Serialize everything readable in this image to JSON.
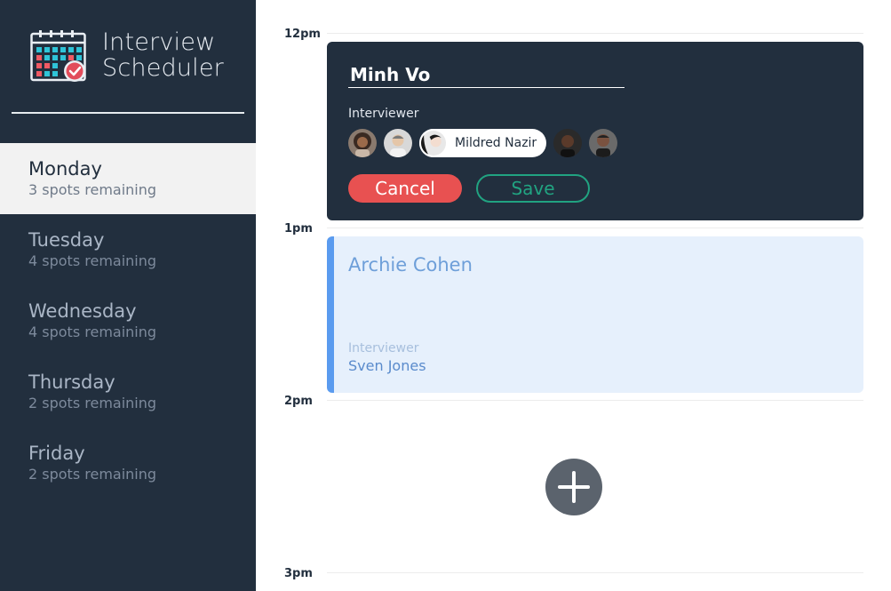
{
  "app": {
    "title_line1": "Interview",
    "title_line2": "Scheduler"
  },
  "sidebar": {
    "days": [
      {
        "name": "Monday",
        "spots": "3 spots remaining",
        "selected": true
      },
      {
        "name": "Tuesday",
        "spots": "4 spots remaining",
        "selected": false
      },
      {
        "name": "Wednesday",
        "spots": "4 spots remaining",
        "selected": false
      },
      {
        "name": "Thursday",
        "spots": "2 spots remaining",
        "selected": false
      },
      {
        "name": "Friday",
        "spots": "2 spots remaining",
        "selected": false
      }
    ]
  },
  "schedule": {
    "times": [
      "12pm",
      "1pm",
      "2pm",
      "3pm"
    ],
    "form": {
      "student_name": "Minh Vo",
      "interviewer_label": "Interviewer",
      "selected_interviewer": "Mildred Nazir",
      "cancel_label": "Cancel",
      "save_label": "Save"
    },
    "appointment": {
      "student": "Archie Cohen",
      "interviewer_label": "Interviewer",
      "interviewer": "Sven Jones"
    }
  },
  "colors": {
    "sidebar_bg": "#222f3e",
    "cancel": "#e85151",
    "save": "#21a381",
    "appointment_accent": "#5a9bef",
    "add_button": "#5b636d"
  },
  "icons": {
    "logo": "calendar-check-icon",
    "add": "plus-icon"
  }
}
